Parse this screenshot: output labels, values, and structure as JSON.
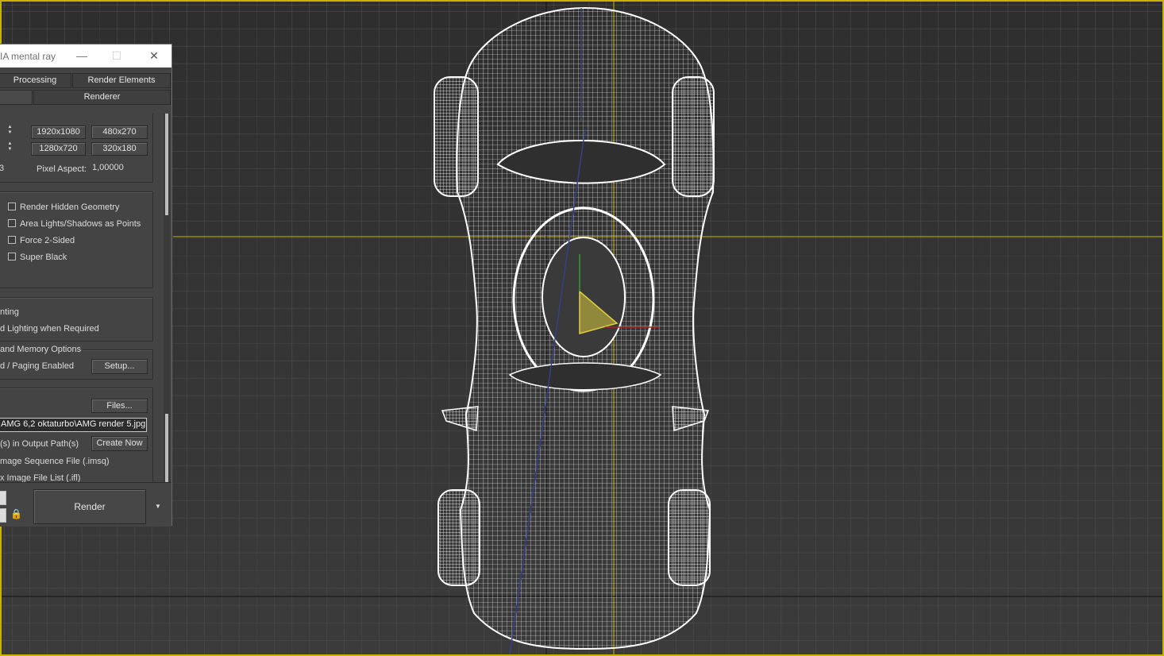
{
  "dialog": {
    "title": "IA mental ray",
    "window_controls": {
      "minimize": "—",
      "maximize": "☐",
      "close": "✕"
    },
    "tabs_row1": [
      "Processing",
      "Render Elements"
    ],
    "tabs_row2": [
      "Renderer"
    ],
    "output_size": {
      "presets": [
        "1920x1080",
        "480x270",
        "1280x720",
        "320x180"
      ],
      "pixel_aspect_label": "Pixel Aspect:",
      "pixel_aspect_value": "1,00000",
      "left_value": "3"
    },
    "options": {
      "checkboxes": [
        {
          "label": "Render Hidden Geometry",
          "checked": false
        },
        {
          "label": "Area Lights/Shadows as Points",
          "checked": false
        },
        {
          "label": "Force 2-Sided",
          "checked": false
        },
        {
          "label": "Super Black",
          "checked": false
        }
      ]
    },
    "lighting": {
      "line1": "nting",
      "line2": "d Lighting when Required"
    },
    "memory": {
      "group_label": "and Memory Options",
      "line": "d / Paging Enabled",
      "setup_button": "Setup..."
    },
    "render_output": {
      "files_button": "Files...",
      "path": "AMG 6,2 oktaturbo\\AMG render 5.jpg",
      "output_paths_label": "(s) in Output Path(s)",
      "create_now_button": "Create Now",
      "imsq_label": "mage Sequence File (.imsq)",
      "ifl_label": "x Image File List (.ifl)"
    },
    "render_button": "Render",
    "render_dropdown": "▼"
  },
  "viewport": {
    "colors": {
      "border": "#c8b400",
      "wireframe": "#ffffff",
      "camera": "#e0d040"
    },
    "icons": [
      "camera-icon",
      "gizmo-axis-icon"
    ]
  }
}
